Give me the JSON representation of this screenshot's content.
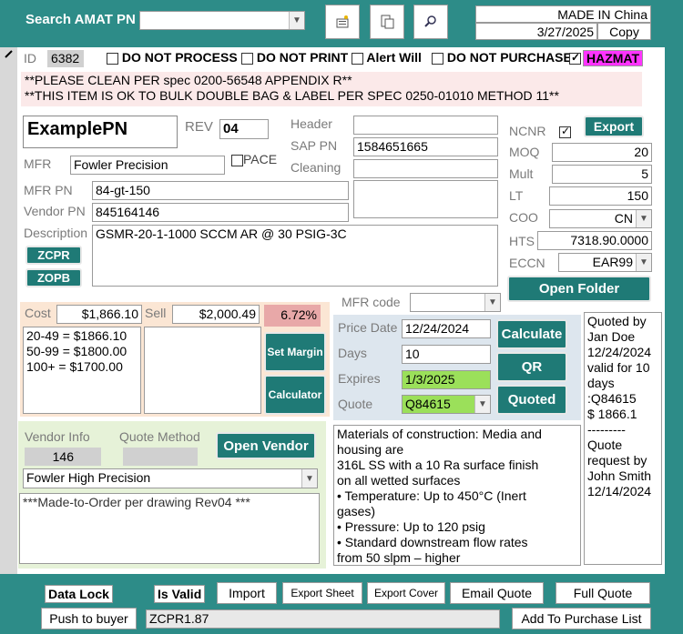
{
  "toolbar": {
    "search_label": "Search AMAT PN",
    "search_value": "",
    "made_in": "MADE IN China",
    "date": "3/27/2025",
    "copy_label": "Copy"
  },
  "flags": {
    "id_label": "ID",
    "id_value": "6382",
    "do_not_process": "DO NOT PROCESS",
    "do_not_print": "DO NOT PRINT",
    "alert_will": "Alert Will",
    "do_not_purchase": "DO NOT PURCHASE",
    "hazmat": "HAZMAT"
  },
  "notes": {
    "line1": "**PLEASE CLEAN PER spec 0200-56548 APPENDIX R**",
    "line2": "**THIS ITEM IS OK TO BULK DOUBLE BAG & LABEL PER SPEC 0250-01010 METHOD 11**"
  },
  "part": {
    "pn": "ExamplePN",
    "rev_label": "REV",
    "rev": "04",
    "header_label": "Header",
    "header_value": "",
    "sap_label": "SAP PN",
    "sap_value": "1584651665",
    "cleaning_label": "Cleaning",
    "cleaning_value": "",
    "mfr_label": "MFR",
    "mfr_value": "Fowler Precision",
    "pace_label": "PACE",
    "mfrpn_label": "MFR PN",
    "mfrpn_value": "84-gt-150",
    "vendorpn_label": "Vendor PN",
    "vendorpn_value": "845164146",
    "desc_label": "Description",
    "desc_value": "GSMR-20-1-1000 SCCM AR @ 30 PSIG-3C",
    "zcpr": "ZCPR",
    "zopb": "ZOPB"
  },
  "right": {
    "ncnr_label": "NCNR",
    "export_label": "Export",
    "moq_label": "MOQ",
    "moq": "20",
    "mult_label": "Mult",
    "mult": "5",
    "lt_label": "LT",
    "lt": "150",
    "coo_label": "COO",
    "coo": "CN",
    "hts_label": "HTS",
    "hts": "7318.90.0000",
    "eccn_label": "ECCN",
    "eccn": "EAR99",
    "open_folder": "Open Folder"
  },
  "pricing": {
    "cost_label": "Cost",
    "cost": "$1,866.10",
    "sell_label": "Sell",
    "sell": "$2,000.49",
    "margin": "6.72%",
    "tiers": [
      "20-49 = $1866.10",
      "50-99 = $1800.00",
      "100+ = $1700.00"
    ],
    "set_margin": "Set Margin",
    "calculator": "Calculator"
  },
  "quote": {
    "mfr_code_label": "MFR code",
    "price_date_label": "Price Date",
    "price_date": "12/24/2024",
    "days_label": "Days",
    "days": "10",
    "expires_label": "Expires",
    "expires": "1/3/2025",
    "quote_label": "Quote",
    "quote": "Q84615",
    "calculate": "Calculate",
    "qr": "QR",
    "quoted": "Quoted"
  },
  "quoted_info": [
    "Quoted by",
    "Jan Doe",
    "12/24/2024",
    "valid for 10",
    "days",
    ":Q84615",
    "$ 1866.1",
    "---------",
    "Quote",
    "request by",
    "John Smith",
    "12/14/2024"
  ],
  "vendor": {
    "info_label": "Vendor Info",
    "method_label": "Quote Method",
    "vendor_id": "146",
    "open_vendor": "Open Vendor",
    "vendor_name": "Fowler High Precision",
    "vendor_note": "***Made-to-Order per drawing Rev04 ***"
  },
  "materials": [
    "Materials of construction: Media and",
    "housing are",
    "316L SS with a 10 Ra surface finish",
    "on all wetted surfaces",
    "• Temperature: Up to 450°C (Inert",
    "gases)",
    "• Pressure: Up to 120 psig",
    "• Standard downstream flow rates",
    "from 50 slpm – higher"
  ],
  "footer": {
    "data_lock": "Data Lock",
    "is_valid": "Is Valid",
    "import": "Import",
    "export_sheet": "Export Sheet",
    "export_cover": "Export Cover",
    "email_quote": "Email Quote",
    "full_quote": "Full Quote",
    "push_to_buyer": "Push to buyer",
    "zcpr_value": "ZCPR1.87",
    "add_to_purchase": "Add To Purchase List"
  },
  "colors": {
    "teal": "#2d8c88",
    "button": "#1f7a76",
    "hazmat": "#ff33ff",
    "note_bg": "#fbe9e9",
    "green_field": "#9be05a",
    "margin_bg": "#e8a8a8"
  }
}
